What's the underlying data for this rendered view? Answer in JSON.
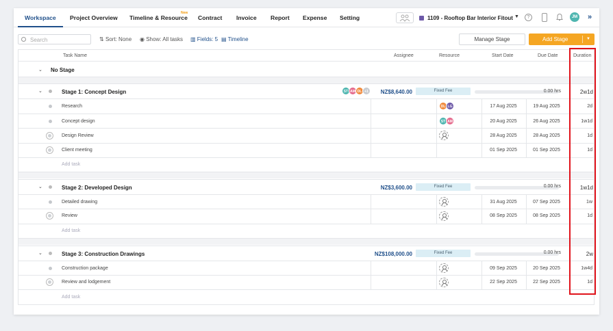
{
  "nav": {
    "tabs": [
      {
        "label": "Workspace"
      },
      {
        "label": "Project Overview"
      },
      {
        "label": "Timeline & Resource"
      },
      {
        "label": "Contract"
      },
      {
        "label": "Invoice"
      },
      {
        "label": "Report"
      },
      {
        "label": "Expense"
      },
      {
        "label": "Setting"
      }
    ],
    "new_badge": "New",
    "project_name": "1109 - Rooftop Bar Interior Fitout",
    "user_initials": "JM",
    "help": "?"
  },
  "toolbar": {
    "search_placeholder": "Search",
    "sort": "Sort: None",
    "show": "Show: All tasks",
    "fields": "Fields: 5",
    "timeline": "Timeline",
    "manage_stage": "Manage Stage",
    "add_stage": "Add Stage"
  },
  "columns": {
    "task_name": "Task Name",
    "assignee": "Assignee",
    "resource": "Resource",
    "start_date": "Start Date",
    "due_date": "Due Date",
    "duration": "Duration"
  },
  "no_stage": "No Stage",
  "add_task": "Add task",
  "stages": [
    {
      "title": "Stage 1: Concept Design",
      "budget": "NZ$8,640.00",
      "fee": "Fixed Fee",
      "hours": "0.00 hrs",
      "duration": "2w1d",
      "avatars": [
        "ST",
        "AM",
        "DL",
        "+1"
      ],
      "tasks": [
        {
          "name": "Research",
          "start": "17 Aug 2025",
          "due": "19 Aug 2025",
          "duration": "2d",
          "resources": [
            "DL",
            "LG"
          ]
        },
        {
          "name": "Concept design",
          "start": "20 Aug 2025",
          "due": "26 Aug 2025",
          "duration": "1w1d",
          "resources": [
            "ST",
            "AM"
          ]
        },
        {
          "name": "Design Review",
          "start": "28 Aug 2025",
          "due": "28 Aug 2025",
          "duration": "1d",
          "resources": []
        },
        {
          "name": "Client meeting",
          "start": "01 Sep 2025",
          "due": "01 Sep 2025",
          "duration": "1d",
          "resources": []
        }
      ]
    },
    {
      "title": "Stage 2: Developed Design",
      "budget": "NZ$3,600.00",
      "fee": "Fixed Fee",
      "hours": "0.00 hrs",
      "duration": "1w1d",
      "tasks": [
        {
          "name": "Detailed drawing",
          "start": "31 Aug 2025",
          "due": "07 Sep 2025",
          "duration": "1w"
        },
        {
          "name": "Review",
          "start": "08 Sep 2025",
          "due": "08 Sep 2025",
          "duration": "1d"
        }
      ]
    },
    {
      "title": "Stage 3: Construction Drawings",
      "budget": "NZ$108,000.00",
      "fee": "Fixed Fee",
      "hours": "0.00 hrs",
      "duration": "2w",
      "tasks": [
        {
          "name": "Construction package",
          "start": "09 Sep 2025",
          "due": "20 Sep 2025",
          "duration": "1w4d"
        },
        {
          "name": "Review and lodgement",
          "start": "22 Sep 2025",
          "due": "22 Sep 2025",
          "duration": "1d"
        }
      ]
    }
  ],
  "colors": {
    "brand": "#1f4f8a",
    "accent": "#f5a623",
    "highlight": "#e0121a",
    "fee_badge": "#dbeef5"
  }
}
